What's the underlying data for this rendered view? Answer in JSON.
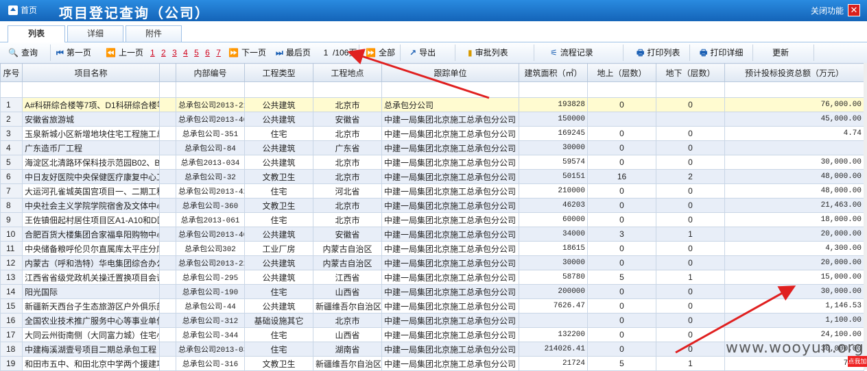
{
  "header": {
    "home_label": "首页",
    "title": "项目登记查询（公司）",
    "close_label": "关闭功能",
    "close_glyph": "✕"
  },
  "tabs": [
    "列表",
    "详细",
    "附件"
  ],
  "toolbar": {
    "query": "查询",
    "first": "第一页",
    "prev": "上一页",
    "pages": [
      "1",
      "2",
      "3",
      "4",
      "5",
      "6",
      "7"
    ],
    "next": "下一页",
    "last": "最后页",
    "page_current": "1",
    "page_total": "/106页",
    "all": "全部",
    "export": "导出",
    "approve_list": "审批列表",
    "flow_record": "流程记录",
    "print_list": "打印列表",
    "print_detail": "打印详细",
    "refresh": "更新"
  },
  "columns": [
    "序号",
    "项目名称",
    "内部编号",
    "工程类型",
    "工程地点",
    "跟踪单位",
    "建筑面积（㎡）",
    "地上（层数）",
    "地下（层数）",
    "预计投标投资总额（万元）"
  ],
  "rows": [
    [
      "1",
      "A#科研综合楼等7项、D1科研综合楼等",
      "总承包公司2013-21",
      "公共建筑",
      "北京市",
      "总承包分公司",
      "193828",
      "0",
      "0",
      "76,000.00"
    ],
    [
      "2",
      "安徽省旅游城",
      "总承包公司2013-40",
      "公共建筑",
      "安徽省",
      "中建一局集团北京施工总承包分公司",
      "150000",
      "",
      "",
      "45,000.00"
    ],
    [
      "3",
      "玉泉新城小区新增地块住宅工程施工总",
      "总承包公司-351",
      "住宅",
      "北京市",
      "中建一局集团北京施工总承包分公司",
      "169245",
      "0",
      "0",
      "4.74"
    ],
    [
      "4",
      "广东造币厂工程",
      "总承包公司-84",
      "公共建筑",
      "广东省",
      "中建一局集团北京施工总承包分公司",
      "30000",
      "0",
      "0",
      ""
    ],
    [
      "5",
      "海淀区北清路环保科技示范园B02、B1",
      "总承包2013-034",
      "公共建筑",
      "北京市",
      "中建一局集团北京施工总承包分公司",
      "59574",
      "0",
      "0",
      "30,000.00"
    ],
    [
      "6",
      "中日友好医院中央保健医疗康复中心工",
      "总承包公司-32",
      "文教卫生",
      "北京市",
      "中建一局集团北京施工总承包分公司",
      "50151",
      "16",
      "2",
      "48,000.00"
    ],
    [
      "7",
      "大运河孔雀城英国宫项目一、二期工程",
      "总承包公司2013-42",
      "住宅",
      "河北省",
      "中建一局集团北京施工总承包分公司",
      "210000",
      "0",
      "0",
      "48,000.00"
    ],
    [
      "8",
      "中央社会主义学院学院宿舍及文体中心",
      "总承包公司-360",
      "文教卫生",
      "北京市",
      "中建一局集团北京施工总承包分公司",
      "46203",
      "0",
      "0",
      "21,463.00"
    ],
    [
      "9",
      "王佐镇佃起村居住项目区A1-A10和D区",
      "总承包2013-061",
      "住宅",
      "北京市",
      "中建一局集团北京施工总承包分公司",
      "60000",
      "0",
      "0",
      "18,000.00"
    ],
    [
      "10",
      "合肥百货大楼集团合家福阜阳购物中心",
      "总承包公司2013-40",
      "公共建筑",
      "安徽省",
      "中建一局集团北京施工总承包分公司",
      "34000",
      "3",
      "1",
      "20,000.00"
    ],
    [
      "11",
      "中央储备粮呼伦贝尔直属库太平庄分库",
      "总承包公司302",
      "工业厂房",
      "内蒙古自治区",
      "中建一局集团北京施工总承包分公司",
      "18615",
      "0",
      "0",
      "4,300.00"
    ],
    [
      "12",
      "内蒙古（呼和浩特）华电集团综合办公",
      "总承包公司2013-22",
      "公共建筑",
      "内蒙古自治区",
      "中建一局集团北京施工总承包分公司",
      "30000",
      "0",
      "0",
      "20,000.00"
    ],
    [
      "13",
      "江西省省级党政机关操迁置换项目会议",
      "总承包公司-295",
      "公共建筑",
      "江西省",
      "中建一局集团北京施工总承包分公司",
      "58780",
      "5",
      "1",
      "15,000.00"
    ],
    [
      "14",
      "阳光国际",
      "总承包公司-190",
      "住宅",
      "山西省",
      "中建一局集团北京施工总承包分公司",
      "200000",
      "0",
      "0",
      "30,000.00"
    ],
    [
      "15",
      "新疆新天西台子生态旅游区户外俱乐部",
      "总承包公司-44",
      "公共建筑",
      "新疆维吾尔自治区",
      "中建一局集团北京施工总承包分公司",
      "7626.47",
      "0",
      "0",
      "1,146.53"
    ],
    [
      "16",
      "全国农业技术推广服务中心等事业单位",
      "总承包公司-312",
      "基础设施其它",
      "北京市",
      "中建一局集团北京施工总承包分公司",
      "",
      "0",
      "0",
      "1,100.00"
    ],
    [
      "17",
      "大同云州街南侧（大同富力城）住宅小",
      "总承包公司-344",
      "住宅",
      "山西省",
      "中建一局集团北京施工总承包分公司",
      "132200",
      "0",
      "0",
      "24,100.00"
    ],
    [
      "18",
      "中建梅溪湖壹号项目二期总承包工程",
      "总承包公司2013-032",
      "住宅",
      "湖南省",
      "中建一局集团北京施工总承包分公司",
      "214026.41",
      "0",
      "0",
      "30,000.00"
    ],
    [
      "19",
      "和田市五中、和田北京中学两个援建项",
      "总承包公司-316",
      "文教卫生",
      "新疆维吾尔自治区",
      "中建一局集团北京施工总承包分公司",
      "21724",
      "5",
      "1",
      "7,16"
    ]
  ],
  "watermark": "www.wooyun.org",
  "badge": "点我加"
}
